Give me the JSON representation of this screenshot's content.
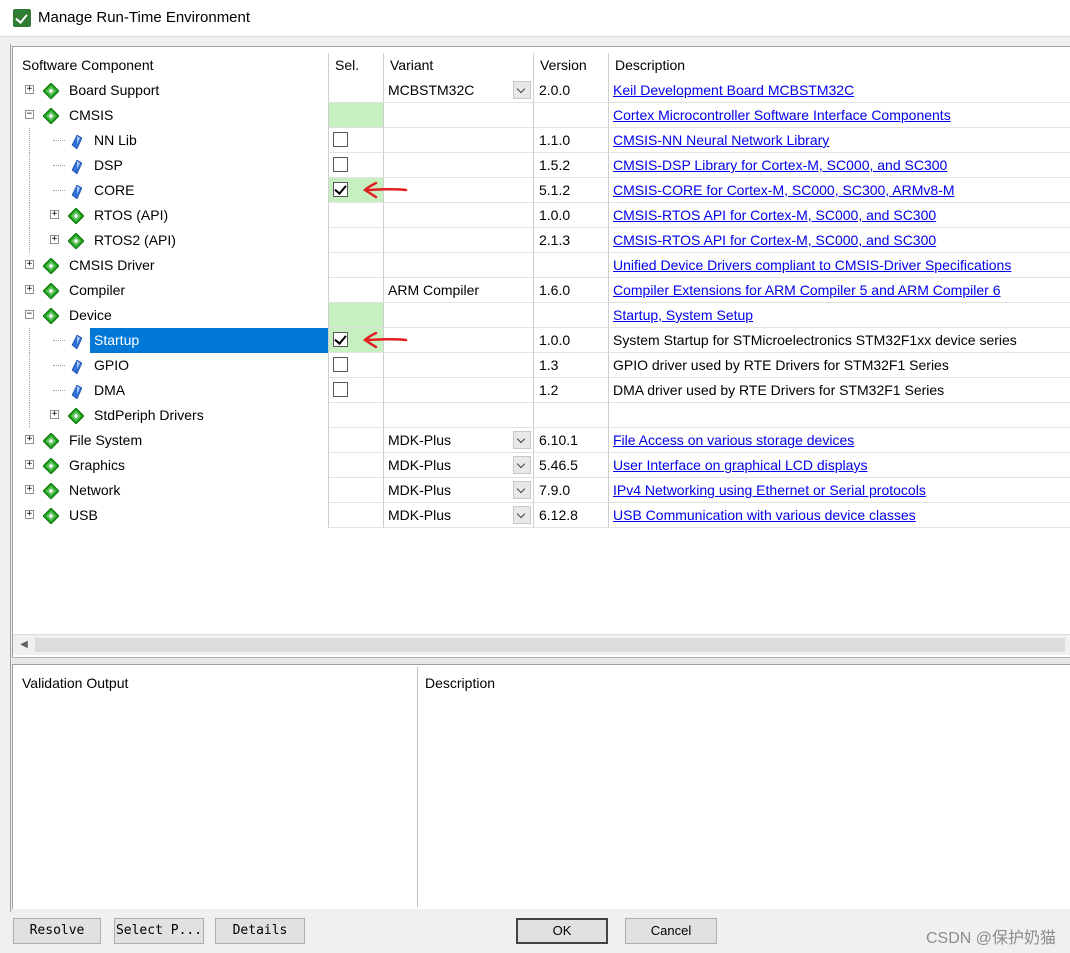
{
  "window": {
    "title": "Manage Run-Time Environment"
  },
  "columns": {
    "component": "Software Component",
    "sel": "Sel.",
    "variant": "Variant",
    "version": "Version",
    "description": "Description"
  },
  "rows": [
    {
      "name": "Board Support",
      "level": 0,
      "expand": "+",
      "icon": "component-gem-icon",
      "sel": "none",
      "sel_green": false,
      "variant": "MCBSTM32C",
      "has_dropdown": true,
      "version": "2.0.0",
      "description": "Keil Development Board MCBSTM32C",
      "link": true
    },
    {
      "name": "CMSIS",
      "level": 0,
      "expand": "-",
      "icon": "component-gem-icon",
      "sel": "none",
      "sel_green": true,
      "variant": "",
      "has_dropdown": false,
      "version": "",
      "description": "Cortex Microcontroller Software Interface Components",
      "link": true
    },
    {
      "name": "NN Lib",
      "level": 1,
      "expand": "",
      "icon": "leaf-component-icon",
      "sel": "unchecked",
      "sel_green": false,
      "variant": "",
      "has_dropdown": false,
      "version": "1.1.0",
      "description": "CMSIS-NN Neural Network Library",
      "link": true
    },
    {
      "name": "DSP",
      "level": 1,
      "expand": "",
      "icon": "leaf-component-icon",
      "sel": "unchecked",
      "sel_green": false,
      "variant": "",
      "has_dropdown": false,
      "version": "1.5.2",
      "description": "CMSIS-DSP Library for Cortex-M, SC000, and SC300",
      "link": true
    },
    {
      "name": "CORE",
      "level": 1,
      "expand": "",
      "icon": "leaf-component-icon",
      "sel": "checked",
      "sel_green": true,
      "variant": "",
      "has_dropdown": false,
      "version": "5.1.2",
      "description": "CMSIS-CORE for Cortex-M, SC000, SC300, ARMv8-M",
      "link": true,
      "annotated": true
    },
    {
      "name": "RTOS (API)",
      "level": 1,
      "expand": "+",
      "icon": "component-gem-icon",
      "sel": "none",
      "sel_green": false,
      "variant": "",
      "has_dropdown": false,
      "version": "1.0.0",
      "description": "CMSIS-RTOS API for Cortex-M, SC000, and SC300",
      "link": true
    },
    {
      "name": "RTOS2 (API)",
      "level": 1,
      "expand": "+",
      "icon": "component-gem-icon",
      "sel": "none",
      "sel_green": false,
      "variant": "",
      "has_dropdown": false,
      "version": "2.1.3",
      "description": "CMSIS-RTOS API for Cortex-M, SC000, and SC300",
      "link": true
    },
    {
      "name": "CMSIS Driver",
      "level": 0,
      "expand": "+",
      "icon": "component-gem-icon",
      "sel": "none",
      "sel_green": false,
      "variant": "",
      "has_dropdown": false,
      "version": "",
      "description": "Unified Device Drivers compliant to CMSIS-Driver Specifications",
      "link": true
    },
    {
      "name": "Compiler",
      "level": 0,
      "expand": "+",
      "icon": "component-gem-icon",
      "sel": "none",
      "sel_green": false,
      "variant": "ARM Compiler",
      "has_dropdown": false,
      "version": "1.6.0",
      "description": "Compiler Extensions for ARM Compiler 5 and ARM Compiler 6",
      "link": true
    },
    {
      "name": "Device",
      "level": 0,
      "expand": "-",
      "icon": "component-gem-icon",
      "sel": "none",
      "sel_green": true,
      "variant": "",
      "has_dropdown": false,
      "version": "",
      "description": "Startup, System Setup",
      "link": true
    },
    {
      "name": "Startup",
      "level": 1,
      "expand": "",
      "icon": "leaf-component-icon",
      "sel": "checked",
      "sel_green": true,
      "variant": "",
      "has_dropdown": false,
      "version": "1.0.0",
      "description": "System Startup for STMicroelectronics STM32F1xx device series",
      "link": false,
      "selected": true,
      "annotated": true
    },
    {
      "name": "GPIO",
      "level": 1,
      "expand": "",
      "icon": "leaf-component-icon",
      "sel": "unchecked",
      "sel_green": false,
      "variant": "",
      "has_dropdown": false,
      "version": "1.3",
      "description": "GPIO driver used by RTE Drivers for STM32F1 Series",
      "link": false
    },
    {
      "name": "DMA",
      "level": 1,
      "expand": "",
      "icon": "leaf-component-icon",
      "sel": "unchecked",
      "sel_green": false,
      "variant": "",
      "has_dropdown": false,
      "version": "1.2",
      "description": "DMA driver used by RTE Drivers for STM32F1 Series",
      "link": false
    },
    {
      "name": "StdPeriph Drivers",
      "level": 1,
      "expand": "+",
      "icon": "component-gem-icon",
      "sel": "none",
      "sel_green": false,
      "variant": "",
      "has_dropdown": false,
      "version": "",
      "description": "",
      "link": false
    },
    {
      "name": "File System",
      "level": 0,
      "expand": "+",
      "icon": "component-gem-icon",
      "sel": "none",
      "sel_green": false,
      "variant": "MDK-Plus",
      "has_dropdown": true,
      "version": "6.10.1",
      "description": "File Access on various storage devices",
      "link": true
    },
    {
      "name": "Graphics",
      "level": 0,
      "expand": "+",
      "icon": "component-gem-icon",
      "sel": "none",
      "sel_green": false,
      "variant": "MDK-Plus",
      "has_dropdown": true,
      "version": "5.46.5",
      "description": "User Interface on graphical LCD displays",
      "link": true
    },
    {
      "name": "Network",
      "level": 0,
      "expand": "+",
      "icon": "component-gem-icon",
      "sel": "none",
      "sel_green": false,
      "variant": "MDK-Plus",
      "has_dropdown": true,
      "version": "7.9.0",
      "description": "IPv4 Networking using Ethernet or Serial protocols",
      "link": true
    },
    {
      "name": "USB",
      "level": 0,
      "expand": "+",
      "icon": "component-gem-icon",
      "sel": "none",
      "sel_green": false,
      "variant": "MDK-Plus",
      "has_dropdown": true,
      "version": "6.12.8",
      "description": "USB Communication with various device classes",
      "link": true
    }
  ],
  "validation": {
    "output_header": "Validation Output",
    "description_header": "Description"
  },
  "buttons": {
    "resolve": "Resolve",
    "select_packs": "Select P...",
    "details": "Details",
    "ok": "OK",
    "cancel": "Cancel"
  },
  "watermark": "CSDN @保护奶猫",
  "colors": {
    "selection": "#0078d7",
    "sel_green": "#c6f0c0",
    "link": "#0000ee",
    "gem_green": "#1aa31a",
    "annotation": "#e02020"
  }
}
